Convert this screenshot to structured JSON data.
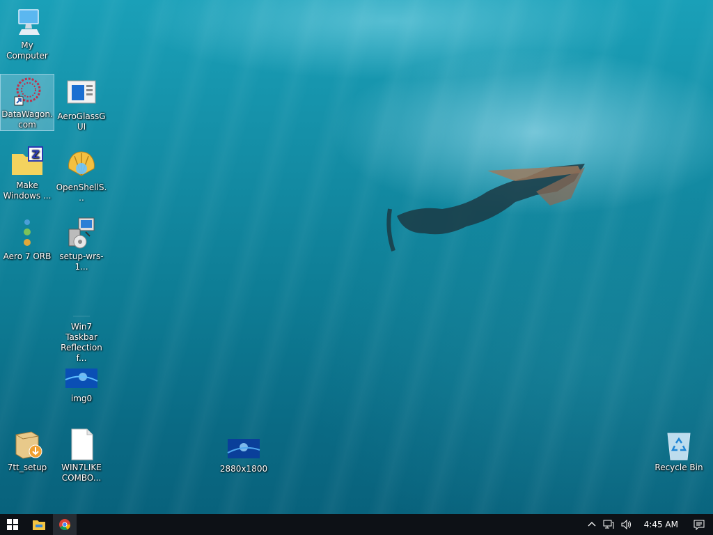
{
  "desktop": {
    "icons": [
      {
        "label": "My Computer",
        "icon": "computer-icon"
      },
      {
        "label": "DataWagon.com",
        "icon": "datawagon-shortcut-icon"
      },
      {
        "label": "AeroGlassGUI",
        "icon": "aeroglass-window-icon"
      },
      {
        "label": "Make Windows ...",
        "icon": "zip-folder-icon"
      },
      {
        "label": "OpenShellS...",
        "icon": "shell-icon"
      },
      {
        "label": "Aero 7 ORB",
        "icon": "orb-icon"
      },
      {
        "label": "setup-wrs-1...",
        "icon": "setup-installer-icon"
      },
      {
        "label": "Win7 Taskbar Reflection f...",
        "icon": "blank-file-icon"
      },
      {
        "label": "img0",
        "icon": "image-thumbnail-icon"
      },
      {
        "label": "7tt_setup",
        "icon": "installer-box-icon"
      },
      {
        "label": "WIN7LIKE COMBO...",
        "icon": "document-icon"
      },
      {
        "label": "2880x1800",
        "icon": "image-thumbnail-icon"
      },
      {
        "label": "Recycle Bin",
        "icon": "recycle-bin-icon"
      }
    ]
  },
  "taskbar": {
    "start": "windows-start-icon",
    "pinned": [
      "file-explorer-icon",
      "chrome-icon"
    ],
    "tray": {
      "clock": "4:45 AM",
      "icons": [
        "chevron-up-icon",
        "network-icon",
        "volume-icon",
        "notification-icon"
      ]
    }
  }
}
